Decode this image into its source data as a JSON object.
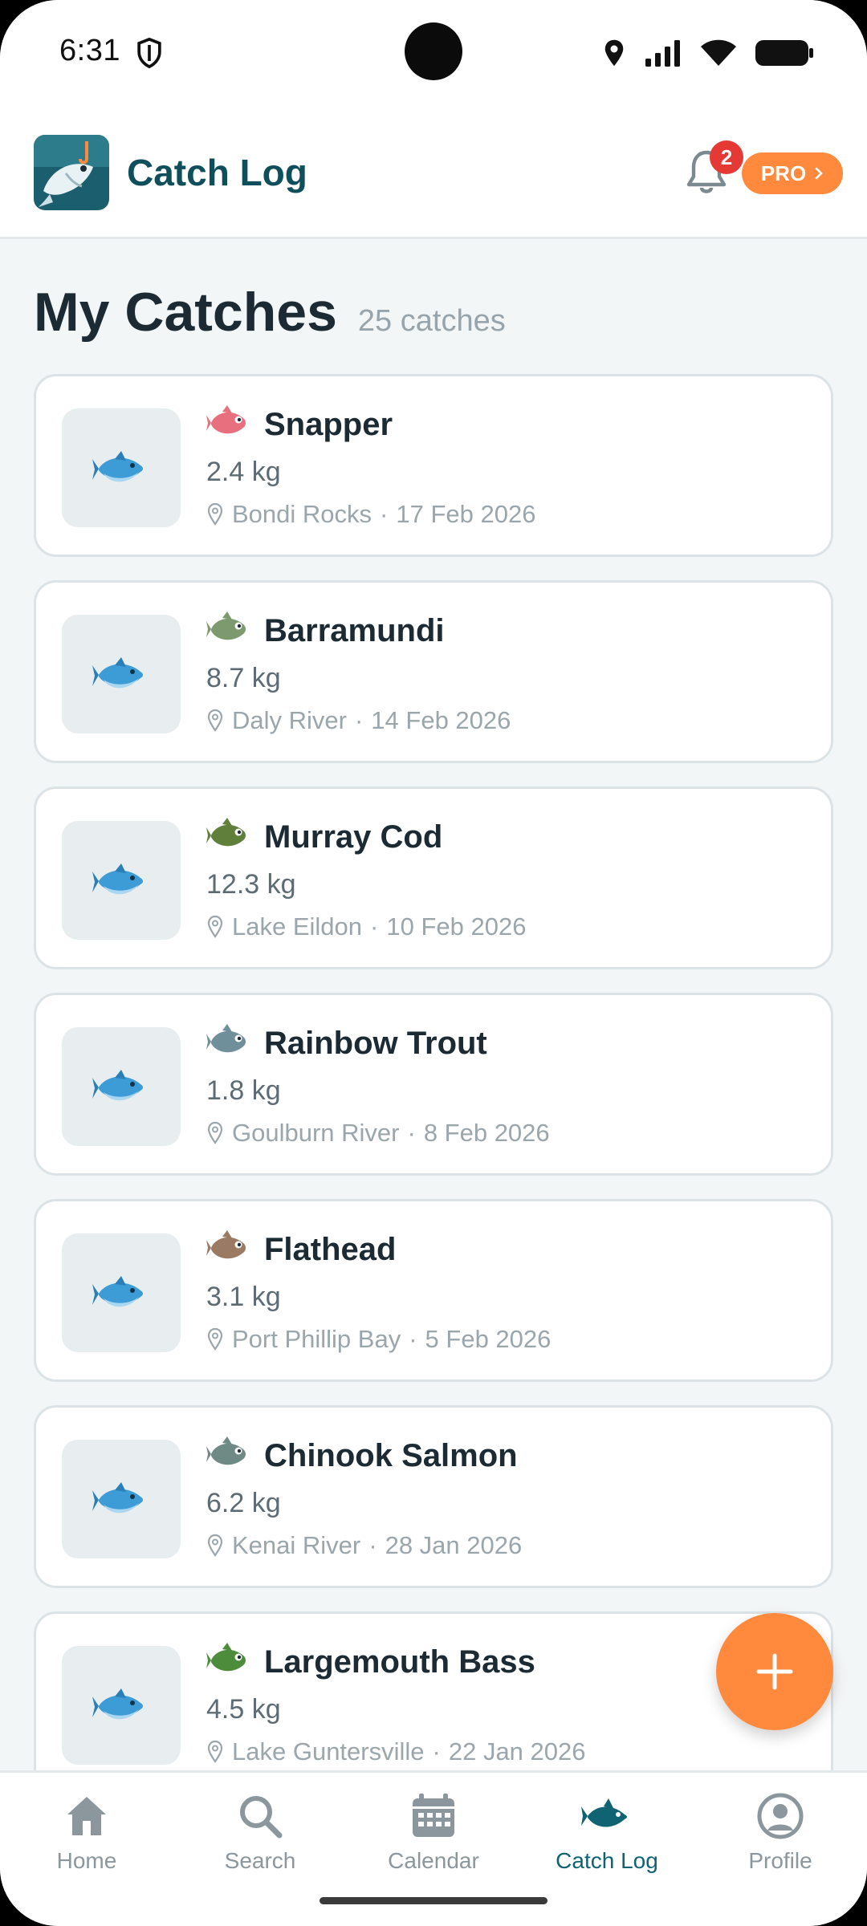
{
  "status_bar": {
    "time": "6:31"
  },
  "header": {
    "title": "Catch Log",
    "notifications_count": "2",
    "pro_label": "PRO"
  },
  "page": {
    "title": "My Catches",
    "count_label": "25 catches"
  },
  "catches": [
    {
      "species": "Snapper",
      "weight": "2.4 kg",
      "location": "Bondi Rocks",
      "date": "17 Feb 2026",
      "icon_color": "#e8707e"
    },
    {
      "species": "Barramundi",
      "weight": "8.7 kg",
      "location": "Daly River",
      "date": "14 Feb 2026",
      "icon_color": "#7c9a6e"
    },
    {
      "species": "Murray Cod",
      "weight": "12.3 kg",
      "location": "Lake Eildon",
      "date": "10 Feb 2026",
      "icon_color": "#5f7f3a"
    },
    {
      "species": "Rainbow Trout",
      "weight": "1.8 kg",
      "location": "Goulburn River",
      "date": "8 Feb 2026",
      "icon_color": "#6f8f9a"
    },
    {
      "species": "Flathead",
      "weight": "3.1 kg",
      "location": "Port Phillip Bay",
      "date": "5 Feb 2026",
      "icon_color": "#9a7a63"
    },
    {
      "species": "Chinook Salmon",
      "weight": "6.2 kg",
      "location": "Kenai River",
      "date": "28 Jan 2026",
      "icon_color": "#6f8a84"
    },
    {
      "species": "Largemouth Bass",
      "weight": "4.5 kg",
      "location": "Lake Guntersville",
      "date": "22 Jan 2026",
      "icon_color": "#4c8c3a"
    }
  ],
  "separator": "·",
  "nav": [
    {
      "label": "Home",
      "icon": "home-icon",
      "active": false
    },
    {
      "label": "Search",
      "icon": "search-icon",
      "active": false
    },
    {
      "label": "Calendar",
      "icon": "calendar-icon",
      "active": false
    },
    {
      "label": "Catch Log",
      "icon": "fish-icon",
      "active": true
    },
    {
      "label": "Profile",
      "icon": "profile-icon",
      "active": false
    }
  ],
  "colors": {
    "accent": "#ff8a3d",
    "brand": "#0f4f5c",
    "active_nav": "#0f6373"
  }
}
